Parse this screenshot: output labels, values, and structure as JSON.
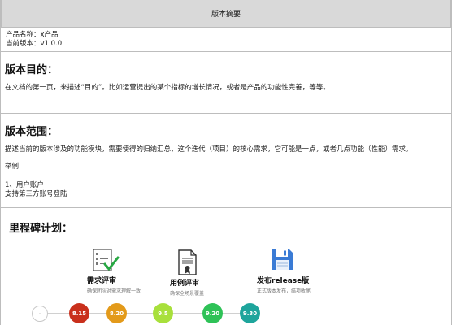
{
  "header": {
    "title": "版本摘要"
  },
  "meta": {
    "product_name": "产品名称：x产品",
    "current_version": "当前版本：v1.0.0"
  },
  "purpose": {
    "heading": "版本目的：",
    "text": "在文档的第一页，来描述“目的”。比如运营提出的某个指标的增长情况，或者是产品的功能性完善，等等。"
  },
  "scope": {
    "heading": "版本范围：",
    "text": "描述当前的版本涉及的功能模块，需要使得的归纳汇总，这个迭代（项目）的核心需求，它可能是一点，或者几点功能（性能）需求。",
    "example_label": "举例:",
    "example_item": "1、用户账户",
    "example_detail": "支持第三方账号登陆"
  },
  "milestone": {
    "heading": "里程碑计划：",
    "stages": [
      {
        "title": "需求评审",
        "desc": "确保团队对需求理解一致",
        "icon": "checklist-icon"
      },
      {
        "title": "用例评审",
        "desc": "确保全场景覆盖",
        "icon": "document-icon"
      },
      {
        "title": "发布release版",
        "desc": "正式版本发布，结项收尾",
        "icon": "save-icon"
      }
    ],
    "timeline": {
      "start_label": "-",
      "dates": [
        {
          "label": "8.15",
          "color": "#c9301c"
        },
        {
          "label": "8.20",
          "color": "#e39a1a"
        },
        {
          "label": "9.5",
          "color": "#a8e03c"
        },
        {
          "label": "9.20",
          "color": "#2ec257"
        },
        {
          "label": "9.30",
          "color": "#1ea59c"
        }
      ]
    }
  }
}
